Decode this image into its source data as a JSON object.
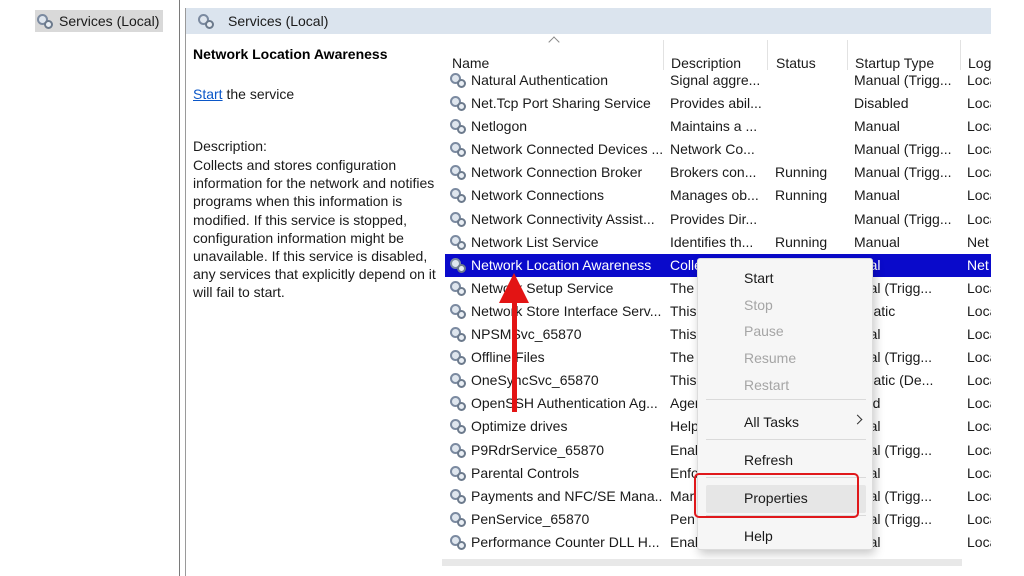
{
  "tree": {
    "root_label": "Services (Local)"
  },
  "header": {
    "title": "Services (Local)"
  },
  "description_pane": {
    "service_name": "Network Location Awareness",
    "start_link": "Start",
    "start_suffix": " the service",
    "description_label": "Description:",
    "description_text": "Collects and stores configuration information for the network and notifies programs when this information is modified. If this service is stopped, configuration information might be unavailable. If this service is disabled, any services that explicitly depend on it will fail to start."
  },
  "columns": [
    "Name",
    "Description",
    "Status",
    "Startup Type",
    "Log"
  ],
  "rows": [
    {
      "name": "Natural Authentication",
      "desc": "Signal aggre...",
      "status": "",
      "startup": "Manual (Trigg...",
      "log": "Loca"
    },
    {
      "name": "Net.Tcp Port Sharing Service",
      "desc": "Provides abil...",
      "status": "",
      "startup": "Disabled",
      "log": "Loca"
    },
    {
      "name": "Netlogon",
      "desc": "Maintains a ...",
      "status": "",
      "startup": "Manual",
      "log": "Loca"
    },
    {
      "name": "Network Connected Devices ...",
      "desc": "Network Co...",
      "status": "",
      "startup": "Manual (Trigg...",
      "log": "Loca"
    },
    {
      "name": "Network Connection Broker",
      "desc": "Brokers con...",
      "status": "Running",
      "startup": "Manual (Trigg...",
      "log": "Loca"
    },
    {
      "name": "Network Connections",
      "desc": "Manages ob...",
      "status": "Running",
      "startup": "Manual",
      "log": "Loca"
    },
    {
      "name": "Network Connectivity Assist...",
      "desc": "Provides Dir...",
      "status": "",
      "startup": "Manual (Trigg...",
      "log": "Loca"
    },
    {
      "name": "Network List Service",
      "desc": "Identifies th...",
      "status": "Running",
      "startup": "Manual",
      "log": "Net"
    },
    {
      "name": "Network Location Awareness",
      "desc": "Colle",
      "status": "",
      "startup": "nual",
      "log": "Net"
    },
    {
      "name": "Network Setup Service",
      "desc": "The",
      "status": "",
      "startup": "nual (Trigg...",
      "log": "Loca"
    },
    {
      "name": "Network Store Interface Serv...",
      "desc": "This",
      "status": "",
      "startup": "omatic",
      "log": "Loca"
    },
    {
      "name": "NPSMSvc_65870",
      "desc": "This",
      "status": "",
      "startup": "nual",
      "log": "Loca"
    },
    {
      "name": "Offline Files",
      "desc": "The",
      "status": "",
      "startup": "nual (Trigg...",
      "log": "Loca"
    },
    {
      "name": "OneSyncSvc_65870",
      "desc": "This",
      "status": "",
      "startup": "omatic (De...",
      "log": "Loca"
    },
    {
      "name": "OpenSSH Authentication Ag...",
      "desc": "Agen",
      "status": "",
      "startup": "bled",
      "log": "Loca"
    },
    {
      "name": "Optimize drives",
      "desc": "Help",
      "status": "",
      "startup": "nual",
      "log": "Loca"
    },
    {
      "name": "P9RdrService_65870",
      "desc": "Enab",
      "status": "",
      "startup": "nual (Trigg...",
      "log": "Loca"
    },
    {
      "name": "Parental Controls",
      "desc": "Enfo",
      "status": "",
      "startup": "nual",
      "log": "Loca"
    },
    {
      "name": "Payments and NFC/SE Mana...",
      "desc": "Mar",
      "status": "",
      "startup": "nual (Trigg...",
      "log": "Loca"
    },
    {
      "name": "PenService_65870",
      "desc": "Pen",
      "status": "",
      "startup": "nual (Trigg...",
      "log": "Loca"
    },
    {
      "name": "Performance Counter DLL H...",
      "desc": "Enab",
      "status": "",
      "startup": "nual",
      "log": "Loca"
    }
  ],
  "context_menu": {
    "start": "Start",
    "stop": "Stop",
    "pause": "Pause",
    "resume": "Resume",
    "restart": "Restart",
    "all_tasks": "All Tasks",
    "refresh": "Refresh",
    "properties": "Properties",
    "help": "Help"
  },
  "colors": {
    "selection": "#0a0acb",
    "annotation": "#e31414",
    "link": "#0b57c8"
  }
}
